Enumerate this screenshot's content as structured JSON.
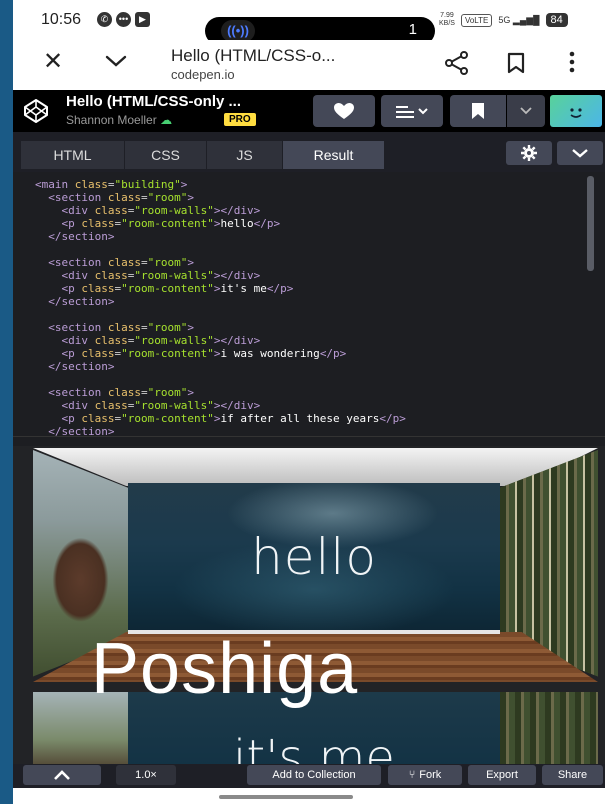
{
  "status_bar": {
    "time": "10:56",
    "notification_icons": [
      "whatsapp-icon",
      "chat-icon",
      "youtube-icon"
    ],
    "cast_pill_count": "1",
    "net_speed": "7.99\nKB/S",
    "volte": "VoLTE",
    "signal": "5G",
    "battery": "84"
  },
  "browser": {
    "title": "Hello (HTML/CSS-o...",
    "url": "codepen.io"
  },
  "codepen": {
    "pen_title": "Hello (HTML/CSS-only ...",
    "author": "Shannon Moeller",
    "badge": "PRO",
    "accent_color": "#ffdd40"
  },
  "tabs": [
    {
      "label": "HTML"
    },
    {
      "label": "CSS"
    },
    {
      "label": "JS"
    },
    {
      "label": "Result"
    }
  ],
  "code_blocks": [
    {
      "text": "hello"
    },
    {
      "text": "it's me"
    },
    {
      "text": "i was wondering"
    },
    {
      "text": "if after all these years"
    }
  ],
  "result": {
    "room1_text": "hello",
    "room2_text": "it's me",
    "watermark": "Poshiga"
  },
  "footer": {
    "zoom": "1.0×",
    "add_to_collection": "Add to Collection",
    "fork": "Fork",
    "export": "Export",
    "share": "Share"
  }
}
